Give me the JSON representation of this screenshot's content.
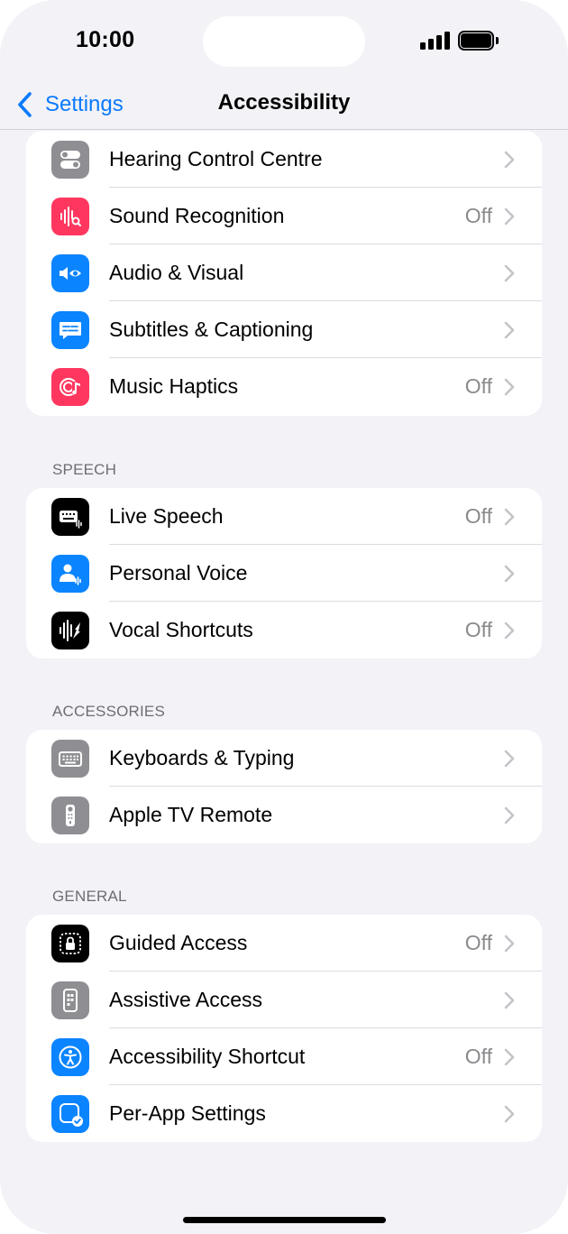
{
  "status": {
    "time": "10:00"
  },
  "nav": {
    "back_label": "Settings",
    "title": "Accessibility"
  },
  "colors": {
    "accent": "#0a7aff",
    "gray_icon": "#8e8e93",
    "pink_icon": "#ff375f",
    "blue_icon": "#0a84ff",
    "black_icon": "#000000"
  },
  "groups": [
    {
      "header": "",
      "rows": [
        {
          "label": "Hearing Control Centre",
          "value": "",
          "icon": "toggle-switches-icon"
        },
        {
          "label": "Sound Recognition",
          "value": "Off",
          "icon": "waveform-search-icon"
        },
        {
          "label": "Audio & Visual",
          "value": "",
          "icon": "speaker-eye-icon"
        },
        {
          "label": "Subtitles & Captioning",
          "value": "",
          "icon": "caption-bubble-icon"
        },
        {
          "label": "Music Haptics",
          "value": "Off",
          "icon": "music-haptics-icon"
        }
      ]
    },
    {
      "header": "SPEECH",
      "rows": [
        {
          "label": "Live Speech",
          "value": "Off",
          "icon": "keyboard-waveform-icon"
        },
        {
          "label": "Personal Voice",
          "value": "",
          "icon": "person-waveform-icon"
        },
        {
          "label": "Vocal Shortcuts",
          "value": "Off",
          "icon": "waveform-arrow-icon"
        }
      ]
    },
    {
      "header": "ACCESSORIES",
      "rows": [
        {
          "label": "Keyboards & Typing",
          "value": "",
          "icon": "keyboard-icon"
        },
        {
          "label": "Apple TV Remote",
          "value": "",
          "icon": "tv-remote-icon"
        }
      ]
    },
    {
      "header": "GENERAL",
      "rows": [
        {
          "label": "Guided Access",
          "value": "Off",
          "icon": "lock-dashed-frame-icon"
        },
        {
          "label": "Assistive Access",
          "value": "",
          "icon": "assistive-access-icon"
        },
        {
          "label": "Accessibility Shortcut",
          "value": "Off",
          "icon": "accessibility-icon"
        },
        {
          "label": "Per-App Settings",
          "value": "",
          "icon": "app-checkmark-icon"
        }
      ]
    }
  ]
}
